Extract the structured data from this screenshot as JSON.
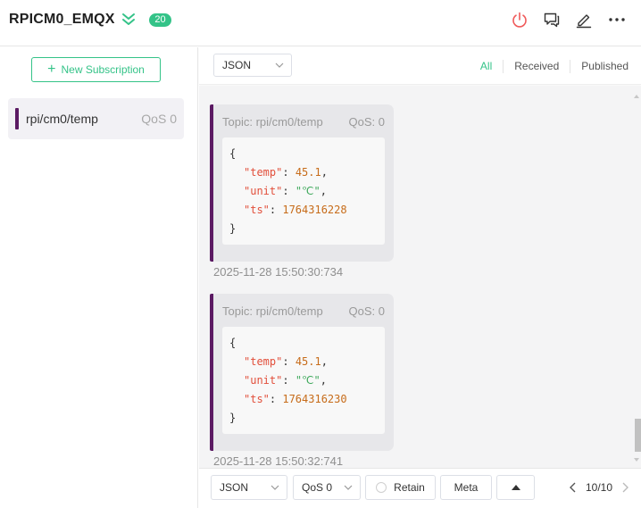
{
  "header": {
    "connection_name": "RPICM0_EMQX",
    "message_count": "20",
    "icons": [
      "double-chevron-down-icon",
      "power-icon",
      "chat-icon",
      "edit-icon",
      "more-icon"
    ],
    "accent_color": "#34c388",
    "disconnect_color": "#f05a5a"
  },
  "sidebar": {
    "new_subscription_label": "New Subscription",
    "subscriptions": [
      {
        "topic": "rpi/cm0/temp",
        "qos": "QoS 0",
        "color": "#5b1a63"
      }
    ]
  },
  "filter": {
    "format": "JSON",
    "tabs": [
      "All",
      "Received",
      "Published"
    ],
    "active_tab": "All"
  },
  "messages": [
    {
      "topic": "Topic: rpi/cm0/temp",
      "qos": "QoS: 0",
      "line_open": "{",
      "k1": "\"temp\"",
      "v1": "45.1",
      "k2": "\"unit\"",
      "v2": "\"℃\"",
      "k3": "\"ts\"",
      "v3": "1764316228",
      "line_close": "}",
      "time": "2025-11-28 15:50:30:734"
    },
    {
      "topic": "Topic: rpi/cm0/temp",
      "qos": "QoS: 0",
      "line_open": "{",
      "k1": "\"temp\"",
      "v1": "45.1",
      "k2": "\"unit\"",
      "v2": "\"℃\"",
      "k3": "\"ts\"",
      "v3": "1764316230",
      "line_close": "}",
      "time": "2025-11-28 15:50:32:741"
    }
  ],
  "composer": {
    "format": "JSON",
    "qos": "QoS 0",
    "retain_label": "Retain",
    "meta_label": "Meta",
    "page": "10/10"
  }
}
